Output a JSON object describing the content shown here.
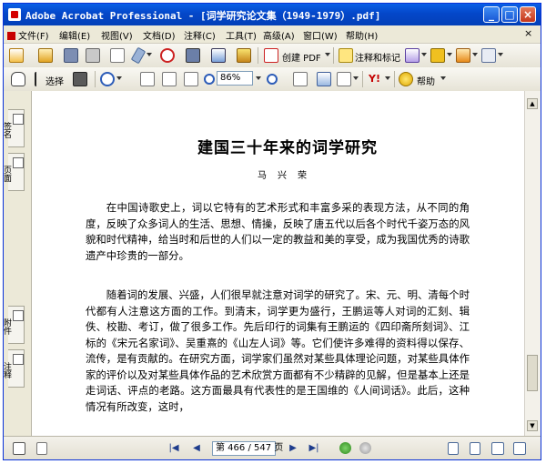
{
  "window": {
    "title": "Adobe Acrobat Professional - [词学研究论文集（1949-1979）.pdf]"
  },
  "menubar": {
    "items": [
      {
        "label": "文件(F)"
      },
      {
        "label": "编辑(E)"
      },
      {
        "label": "视图(V)"
      },
      {
        "label": "文档(D)"
      },
      {
        "label": "注释(C)"
      },
      {
        "label": "工具(T)"
      },
      {
        "label": "高级(A)"
      },
      {
        "label": "窗口(W)"
      },
      {
        "label": "帮助(H)"
      }
    ]
  },
  "toolbar1": {
    "create_pdf_label": "创建 PDF",
    "comment_label": "注释和标记"
  },
  "toolbar2": {
    "select_label": "选择",
    "zoom_value": "86%",
    "help_label": "帮助"
  },
  "nav_tabs": {
    "tabs": [
      {
        "label": "签名"
      },
      {
        "label": "页面"
      },
      {
        "label": "附件"
      },
      {
        "label": "注释"
      }
    ]
  },
  "document": {
    "title": "建国三十年来的词学研究",
    "author": "马兴荣",
    "paragraphs": [
      "在中国诗歌史上，词以它特有的艺术形式和丰富多采的表现方法，从不同的角度，反映了众多词人的生活、思想、情操，反映了唐五代以后各个时代千姿万态的风貌和时代精神，给当时和后世的人们以一定的教益和美的享受，成为我国优秀的诗歌遗产中珍贵的一部分。",
      "随着词的发展、兴盛，人们很早就注意对词学的研究了。宋、元、明、清每个时代都有人注意这方面的工作。到清末，词学更为盛行，王鹏运等人对词的汇刻、辑佚、校勘、考订，做了很多工作。先后印行的词集有王鹏运的《四印斋所刻词》、江标的《宋元名家词》、吴重熹的《山左人词》等。它们使许多难得的资料得以保存、流传，是有贡献的。在研究方面，词学家们虽然对某些具体理论问题，对某些具体作家的评价以及对某些具体作品的艺术欣赏方面都有不少精辟的见解，但是基本上还是走词话、评点的老路。这方面最具有代表性的是王国维的《人间词话》。此后，这种情况有所改变，这时，"
    ]
  },
  "statusbar": {
    "page_indicator": "第 466 / 547 页"
  },
  "colors": {
    "titlebar": "#0447c9",
    "chrome": "#ece9d8",
    "page": "#ffffff"
  }
}
